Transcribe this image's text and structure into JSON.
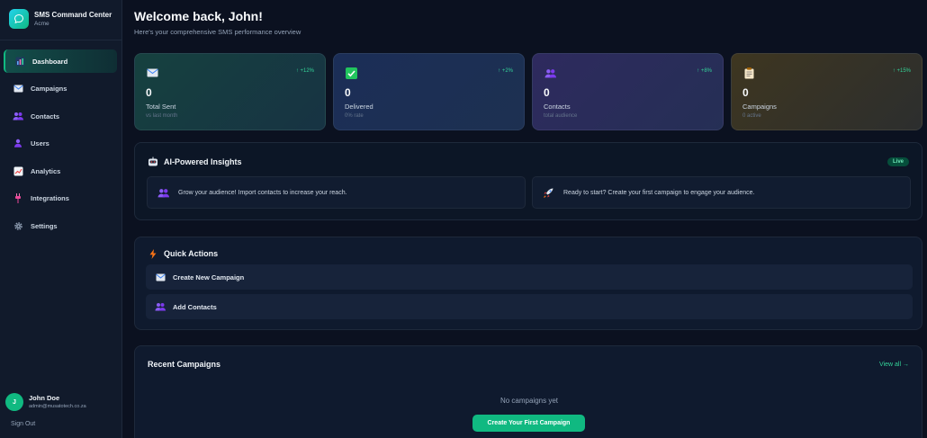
{
  "brand": {
    "name": "SMS Command Center",
    "org": "Acme"
  },
  "nav": [
    {
      "label": "Dashboard",
      "icon": "bar-chart-icon",
      "active": true
    },
    {
      "label": "Campaigns",
      "icon": "envelope-icon"
    },
    {
      "label": "Contacts",
      "icon": "people-icon"
    },
    {
      "label": "Users",
      "icon": "person-icon"
    },
    {
      "label": "Analytics",
      "icon": "line-chart-icon"
    },
    {
      "label": "Integrations",
      "icon": "plug-icon"
    },
    {
      "label": "Settings",
      "icon": "gear-icon"
    }
  ],
  "user": {
    "initial": "J",
    "name": "John Doe",
    "email": "admin@musatotech.co.za",
    "signout": "Sign Out"
  },
  "header": {
    "title": "Welcome back, John!",
    "subtitle": "Here's your comprehensive SMS performance overview"
  },
  "stats": [
    {
      "icon": "envelope-icon",
      "trend": "↑ +12%",
      "value": "0",
      "label": "Total Sent",
      "sub": "vs last month"
    },
    {
      "icon": "checkmark-icon",
      "trend": "↑ +2%",
      "value": "0",
      "label": "Delivered",
      "sub": "0% rate"
    },
    {
      "icon": "people-icon",
      "trend": "↑ +8%",
      "value": "0",
      "label": "Contacts",
      "sub": "total audience"
    },
    {
      "icon": "clipboard-icon",
      "trend": "↑ +15%",
      "value": "0",
      "label": "Campaigns",
      "sub": "0 active"
    }
  ],
  "insights": {
    "title": "AI-Powered Insights",
    "badge": "Live",
    "items": [
      {
        "icon": "people-icon",
        "text": "Grow your audience! Import contacts to increase your reach."
      },
      {
        "icon": "rocket-icon",
        "text": "Ready to start? Create your first campaign to engage your audience."
      }
    ]
  },
  "quick_actions": {
    "title": "Quick Actions",
    "items": [
      {
        "icon": "envelope-icon",
        "label": "Create New Campaign"
      },
      {
        "icon": "people-icon",
        "label": "Add Contacts"
      }
    ]
  },
  "recent": {
    "title": "Recent Campaigns",
    "view_all": "View all →",
    "empty": "No campaigns yet",
    "cta": "Create Your First Campaign"
  },
  "colors": {
    "accent": "#10b981",
    "background": "#0b1120",
    "sidebar": "#111a2b"
  }
}
